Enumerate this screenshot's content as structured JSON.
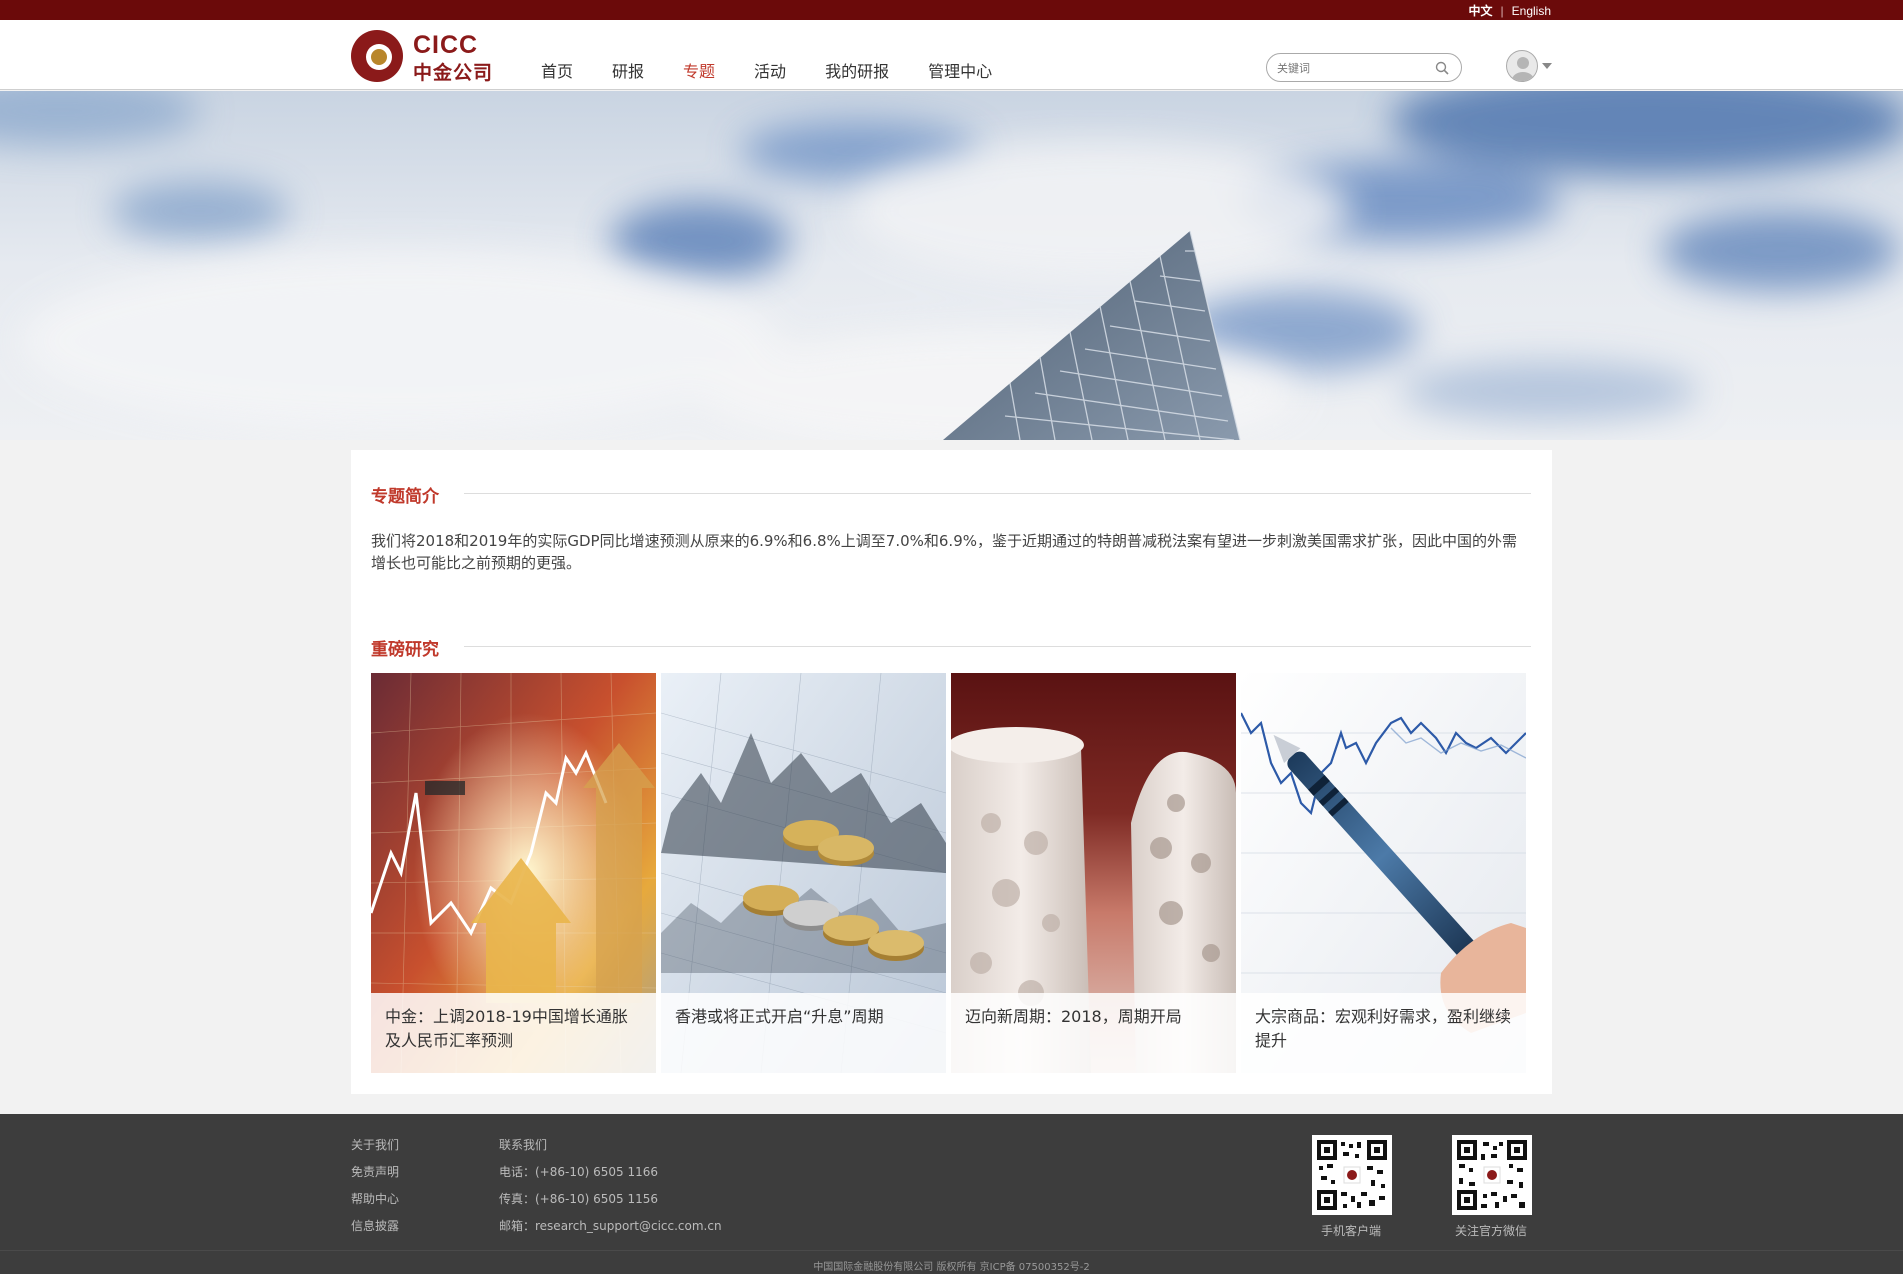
{
  "lang": {
    "zh": "中文",
    "sep": "|",
    "en": "English"
  },
  "logo": {
    "en": "CICC",
    "cn": "中金公司"
  },
  "nav": [
    {
      "label": "首页",
      "active": false
    },
    {
      "label": "研报",
      "active": false
    },
    {
      "label": "专题",
      "active": true
    },
    {
      "label": "活动",
      "active": false
    },
    {
      "label": "我的研报",
      "active": false
    },
    {
      "label": "管理中心",
      "active": false
    }
  ],
  "search": {
    "placeholder": "关键词",
    "icon": "search-icon"
  },
  "user": {
    "icon": "user-avatar-icon"
  },
  "intro": {
    "title": "专题简介",
    "text": "我们将2018和2019年的实际GDP同比增速预测从原来的6.9%和6.8%上调至7.0%和6.9%，鉴于近期通过的特朗普减税法案有望进一步刺激美国需求扩张，因此中国的外需增长也可能比之前预期的更强。"
  },
  "featured": {
    "title": "重磅研究",
    "items": [
      {
        "caption": "中金：上调2018-19中国增长通胀及人民币汇率预测"
      },
      {
        "caption": "香港或将正式开启“升息”周期"
      },
      {
        "caption": "迈向新周期：2018，周期开局"
      },
      {
        "caption": "大宗商品：宏观利好需求，盈利继续提升"
      }
    ]
  },
  "footer": {
    "col1": [
      "关于我们",
      "免责声明",
      "帮助中心",
      "信息披露"
    ],
    "col2": [
      "联系我们",
      "电话：(+86-10) 6505 1166",
      "传真：(+86-10) 6505 1156",
      "邮箱：research_support@cicc.com.cn"
    ],
    "qr": [
      {
        "label": "手机客户端"
      },
      {
        "label": "关注官方微信"
      }
    ],
    "copyright": "中国国际金融股份有限公司 版权所有 京ICP备 07500352号-2"
  },
  "colors": {
    "brand": "#6b0a0a",
    "accent": "#c0392b",
    "footer": "#3d3d3d"
  }
}
